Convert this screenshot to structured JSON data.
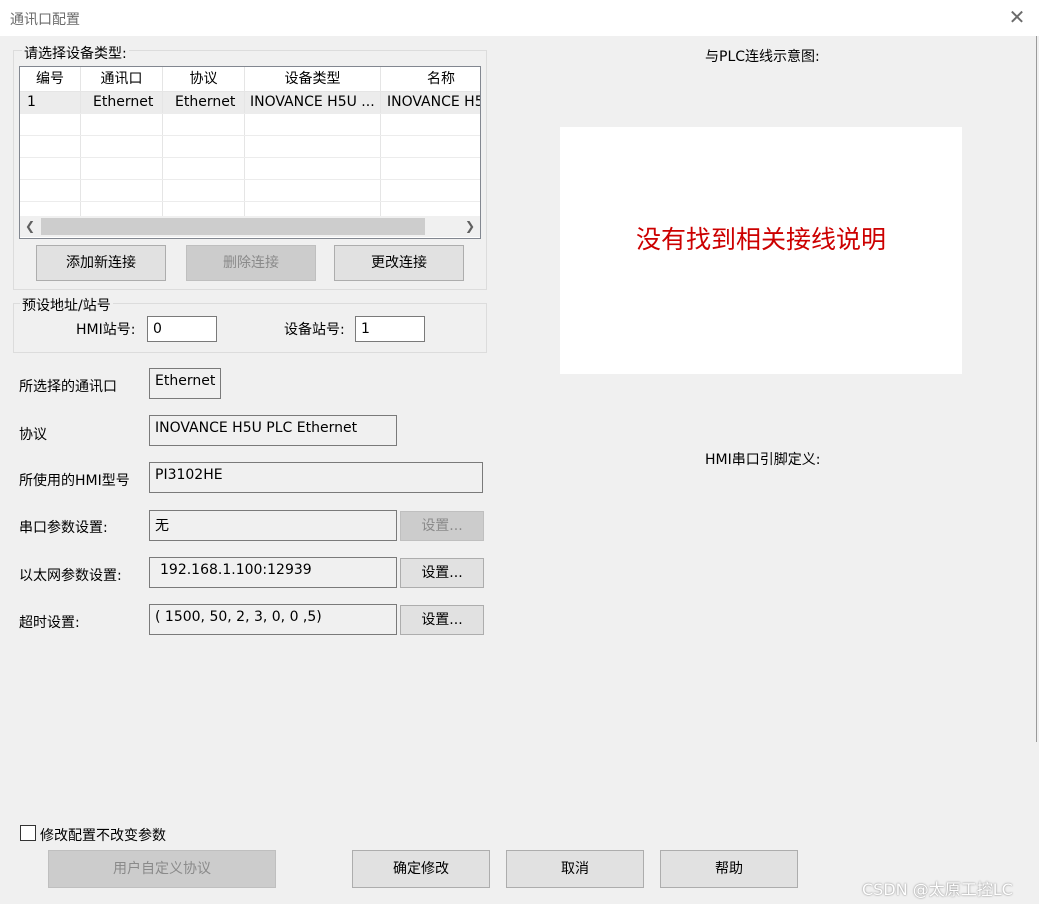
{
  "window": {
    "title": "通讯口配置",
    "close_icon": "close-icon"
  },
  "device_type_group": {
    "label": "请选择设备类型:",
    "table": {
      "headers": [
        "编号",
        "通讯口",
        "协议",
        "设备类型",
        "名称"
      ],
      "rows": [
        [
          "1",
          "Ethernet",
          "Ethernet",
          "INOVANCE H5U ...",
          "INOVANCE H5"
        ]
      ]
    },
    "scroll": {
      "left_icon": "chevron-left-icon",
      "right_icon": "chevron-right-icon"
    },
    "buttons": {
      "add": "添加新连接",
      "delete": "删除连接",
      "change": "更改连接"
    }
  },
  "preset_group": {
    "label": "预设地址/站号",
    "hmi_station_label": "HMI站号:",
    "hmi_station_value": "0",
    "device_station_label": "设备站号:",
    "device_station_value": "1"
  },
  "fields": {
    "port_label": "所选择的通讯口",
    "port_value": "Ethernet",
    "protocol_label": "协议",
    "protocol_value": "INOVANCE H5U PLC Ethernet",
    "hmi_model_label": "所使用的HMI型号",
    "hmi_model_value": "PI3102HE",
    "serial_label": "串口参数设置:",
    "serial_value": "无",
    "serial_button": "设置...",
    "ethernet_label": "以太网参数设置:",
    "ethernet_value": "192.168.1.100:12939",
    "ethernet_button": "设置...",
    "timeout_label": "超时设置:",
    "timeout_value": "( 1500, 50, 2, 3, 0, 0 ,5)",
    "timeout_button": "设置..."
  },
  "right_panel": {
    "diagram_label": "与PLC连线示意图:",
    "no_wiring_text": "没有找到相关接线说明",
    "pin_label": "HMI串口引脚定义:"
  },
  "bottom": {
    "checkbox_label": "修改配置不改变参数",
    "custom_protocol": "用户自定义协议",
    "ok": "确定修改",
    "cancel": "取消",
    "help": "帮助"
  },
  "watermark": "CSDN @太原工控LC",
  "colors": {
    "warning_text": "#cc0000",
    "disabled_button": "#cccccc"
  }
}
